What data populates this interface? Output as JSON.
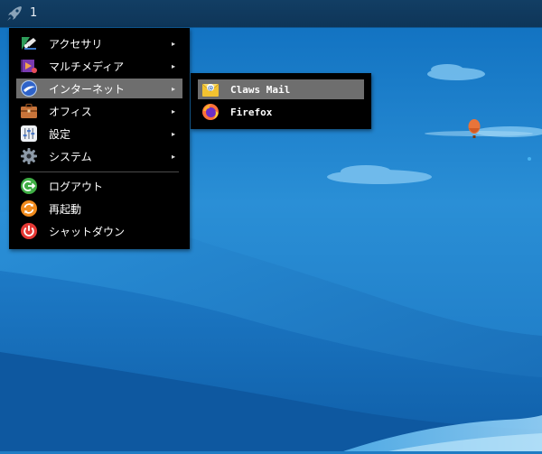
{
  "taskbar": {
    "launcher_icon": "rocket-icon",
    "workspace": "1"
  },
  "main_menu": {
    "items": [
      {
        "label": "アクセサリ",
        "icon": "accessories-icon",
        "has_submenu": true
      },
      {
        "label": "マルチメディア",
        "icon": "multimedia-icon",
        "has_submenu": true
      },
      {
        "label": "インターネット",
        "icon": "internet-icon",
        "has_submenu": true,
        "highlighted": true
      },
      {
        "label": "オフィス",
        "icon": "office-icon",
        "has_submenu": true
      },
      {
        "label": "設定",
        "icon": "settings-icon",
        "has_submenu": true
      },
      {
        "label": "システム",
        "icon": "system-icon",
        "has_submenu": true
      }
    ],
    "actions": [
      {
        "label": "ログアウト",
        "icon": "logout-icon"
      },
      {
        "label": "再起動",
        "icon": "restart-icon"
      },
      {
        "label": "シャットダウン",
        "icon": "shutdown-icon"
      }
    ],
    "submenu_arrow": "▸"
  },
  "internet_submenu": {
    "items": [
      {
        "label": "Claws Mail",
        "icon": "claws-mail-icon",
        "highlighted": true
      },
      {
        "label": "Firefox",
        "icon": "firefox-icon"
      }
    ]
  },
  "colors": {
    "menu_bg": "#000000",
    "highlight": "#6e6e6e",
    "taskbar": "#123e64",
    "desktop_sky": "#1f7cc4"
  }
}
